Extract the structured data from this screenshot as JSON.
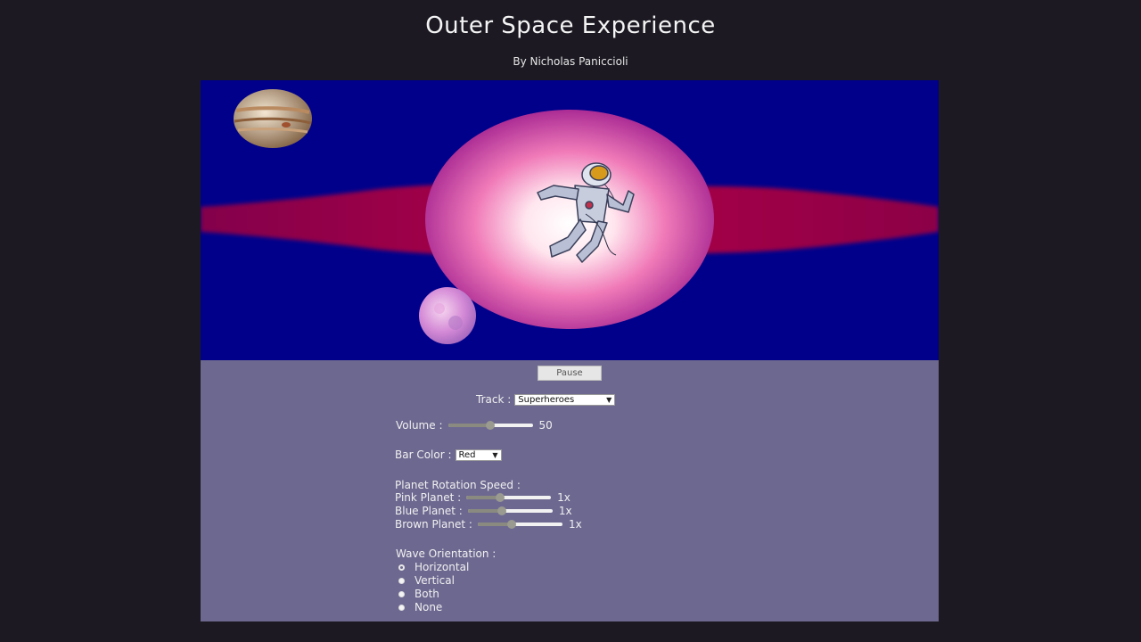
{
  "header": {
    "title": "Outer Space Experience",
    "subtitle": "By Nicholas Paniccioli"
  },
  "stage": {
    "background": "#00008b",
    "wave_color": "#9b0040",
    "orb_colors": [
      "#ffffff",
      "#ff9ec4",
      "#a0208f"
    ],
    "objects": [
      "brown-planet-icon",
      "pink-planet-icon",
      "astronaut-icon"
    ]
  },
  "controls": {
    "pause_label": "Pause",
    "track": {
      "label": "Track :",
      "value": "Superheroes"
    },
    "volume": {
      "label": "Volume :",
      "value": "50",
      "level": 0.5
    },
    "bar_color": {
      "label": "Bar Color :",
      "value": "Red"
    },
    "planet_speed": {
      "heading": "Planet Rotation Speed :",
      "pink": {
        "label": "Pink Planet :",
        "value": "1x",
        "level": 0.4
      },
      "blue": {
        "label": "Blue Planet :",
        "value": "1x",
        "level": 0.4
      },
      "brown": {
        "label": "Brown Planet :",
        "value": "1x",
        "level": 0.4
      }
    },
    "wave_orientation": {
      "heading": "Wave Orientation :",
      "options": [
        "Horizontal",
        "Vertical",
        "Both",
        "None"
      ],
      "selected": "Horizontal"
    }
  }
}
